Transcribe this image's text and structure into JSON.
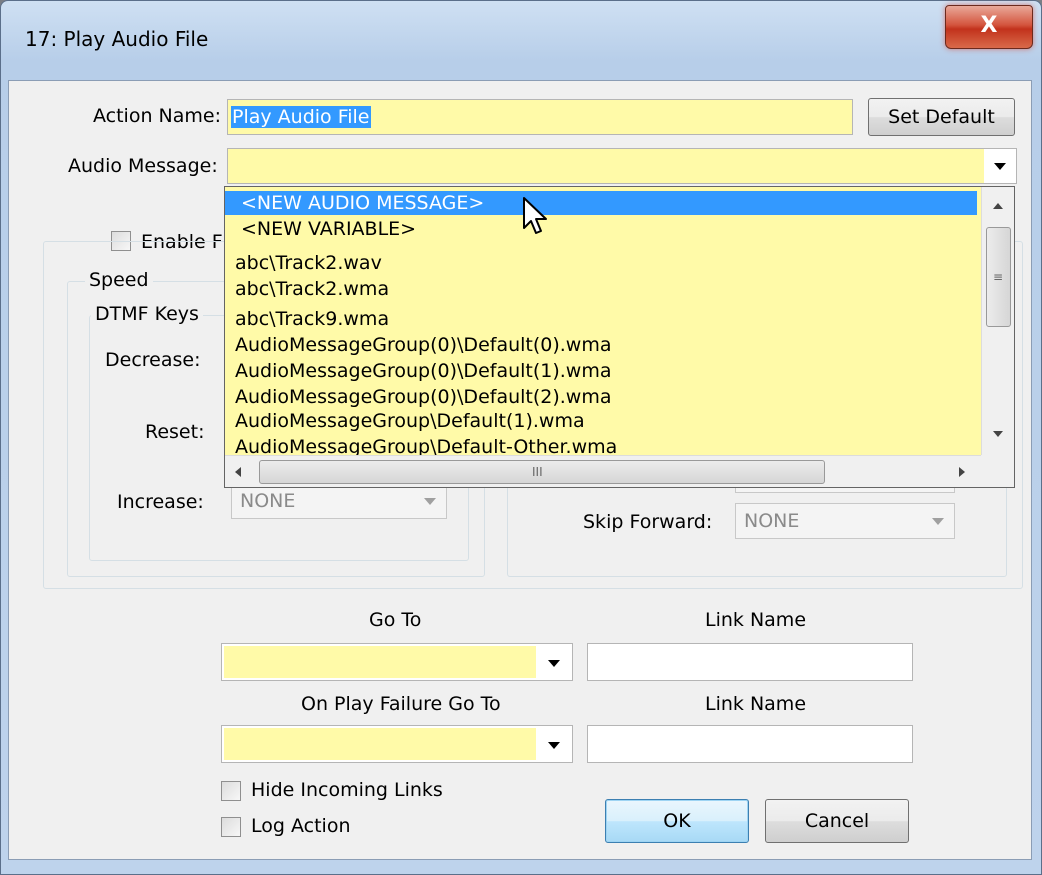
{
  "window": {
    "title": "17: Play Audio File",
    "close_label": "X"
  },
  "form": {
    "action_name_label": "Action Name:",
    "action_name_value": "Play Audio File",
    "set_default_label": "Set Default",
    "audio_message_label": "Audio Message:",
    "audio_message_value": "",
    "enable_label": "Enable F",
    "speed_group": "Speed",
    "dtmf_group": "DTMF Keys",
    "decrease_label": "Decrease:",
    "reset_label": "Reset:",
    "increase_label": "Increase:",
    "increase_value": "NONE",
    "skip_forward_label": "Skip Forward:",
    "skip_forward_value": "NONE",
    "goto_label": "Go To",
    "link_name_label_1": "Link Name",
    "on_fail_label": "On Play Failure Go To",
    "link_name_label_2": "Link Name",
    "hide_links_label": "Hide Incoming Links",
    "log_action_label": "Log Action",
    "ok_label": "OK",
    "cancel_label": "Cancel"
  },
  "dropdown": {
    "items": [
      "<NEW AUDIO MESSAGE>",
      "<NEW VARIABLE>",
      "abc\\Track2.wav",
      "abc\\Track2.wma",
      "abc\\Track9.wma",
      "AudioMessageGroup(0)\\Default(0).wma",
      "AudioMessageGroup(0)\\Default(1).wma",
      "AudioMessageGroup(0)\\Default(2).wma",
      "AudioMessageGroup\\Default(1).wma",
      "AudioMessageGroup\\Default-Other.wma"
    ],
    "selected_index": 0,
    "hscroll_grip": "III",
    "vscroll_grip": "≡"
  },
  "colors": {
    "field_yellow": "#fffaa8",
    "selection_blue": "#3399ff"
  }
}
